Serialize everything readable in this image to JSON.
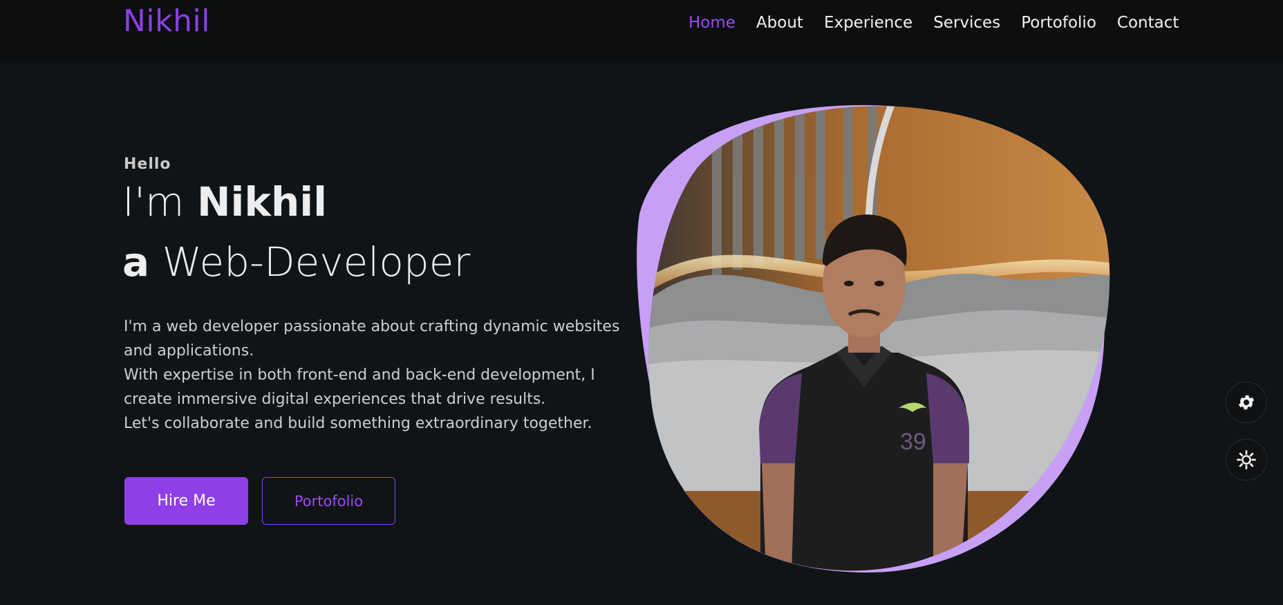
{
  "header": {
    "logo": "Nikhil",
    "nav": [
      {
        "label": "Home",
        "active": true
      },
      {
        "label": "About",
        "active": false
      },
      {
        "label": "Experience",
        "active": false
      },
      {
        "label": "Services",
        "active": false
      },
      {
        "label": "Portofolio",
        "active": false
      },
      {
        "label": "Contact",
        "active": false
      }
    ]
  },
  "hero": {
    "greeting": "Hello",
    "intro_prefix": "I'm",
    "name": "Nikhil",
    "role_prefix": "a",
    "role": "Web-Developer",
    "description": [
      "I'm a web developer passionate about crafting dynamic websites and applications.",
      "With expertise in both front-end and back-end development, I create immersive digital experiences that drive results.",
      "Let's collaborate and build something extraordinary together."
    ],
    "hire_button": "Hire Me",
    "portfolio_button": "Portofolio",
    "photo_icon": "portrait-photo"
  },
  "floating": {
    "settings_icon": "gear-icon",
    "theme_icon": "sun-gear-icon"
  },
  "colors": {
    "accent": "#8e3fe6",
    "blob": "#c7a0f5",
    "background": "#111417",
    "header_bg": "#0c0e10"
  }
}
